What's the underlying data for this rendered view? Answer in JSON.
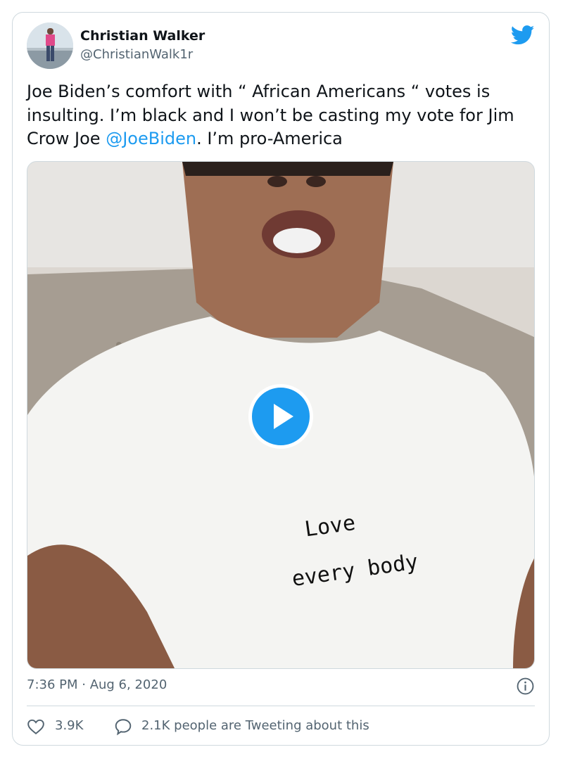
{
  "author": {
    "name": "Christian Walker",
    "handle": "@ChristianWalk1r"
  },
  "tweet": {
    "text_before": "Joe Biden’s comfort with “ African Americans “ votes is insulting. I’m black and I won’t be casting my vote for Jim Crow Joe ",
    "mention": "@JoeBiden",
    "text_after": ". I’m pro-America"
  },
  "media": {
    "shirt_text_line1": "Love",
    "shirt_text_line2": "every body"
  },
  "meta": {
    "timestamp": "7:36 PM · Aug 6, 2020"
  },
  "actions": {
    "likes": "3.9K",
    "reply_text": "2.1K people are Tweeting about this"
  },
  "colors": {
    "accent": "#1d9bf0",
    "secondary_text": "#536471",
    "border": "#cfd9de"
  },
  "icons": {
    "brand": "twitter-bird-icon",
    "play": "play-icon",
    "info": "info-icon",
    "like": "heart-icon",
    "reply": "speech-bubble-icon"
  }
}
